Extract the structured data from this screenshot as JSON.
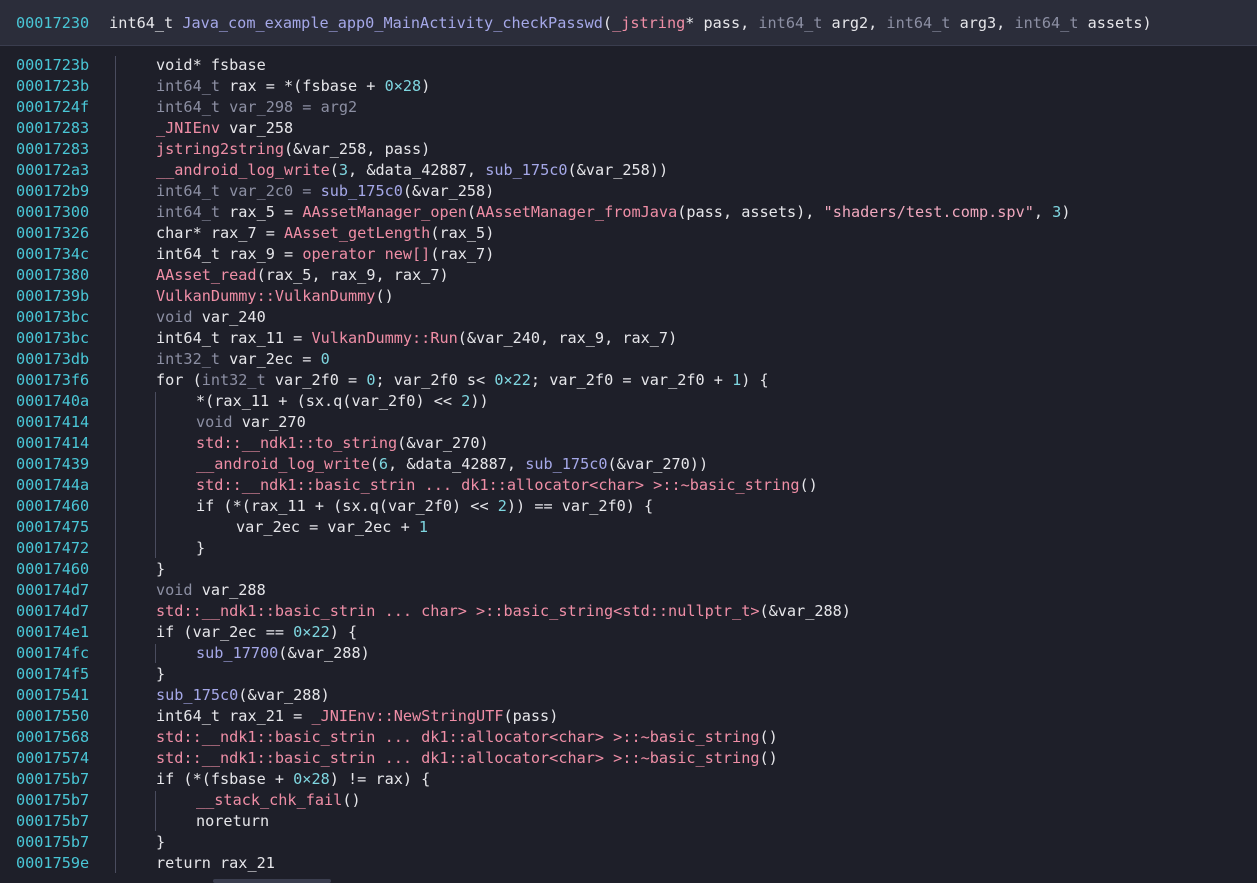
{
  "header": {
    "address": "00017230",
    "signature": [
      {
        "t": "int64_t ",
        "c": "kw"
      },
      {
        "t": "Java_com_example_app0_MainActivity_checkPasswd",
        "c": "imp"
      },
      {
        "t": "(",
        "c": "kw"
      },
      {
        "t": "_jstring",
        "c": "fn"
      },
      {
        "t": "* pass, ",
        "c": "kw"
      },
      {
        "t": "int64_t ",
        "c": "ty"
      },
      {
        "t": "arg2, ",
        "c": "kw"
      },
      {
        "t": "int64_t ",
        "c": "ty"
      },
      {
        "t": "arg3, ",
        "c": "kw"
      },
      {
        "t": "int64_t ",
        "c": "ty"
      },
      {
        "t": "assets)",
        "c": "kw"
      }
    ]
  },
  "lines": [
    {
      "addr": "0001723b",
      "indent": 0,
      "parts": [
        {
          "t": "void",
          "c": "kw"
        },
        {
          "t": "* fsbase",
          "c": "kw"
        }
      ]
    },
    {
      "addr": "0001723b",
      "indent": 0,
      "parts": [
        {
          "t": "int64_t ",
          "c": "ty"
        },
        {
          "t": "rax = *(fsbase + ",
          "c": "kw"
        },
        {
          "t": "0×28",
          "c": "num"
        },
        {
          "t": ")",
          "c": "kw"
        }
      ]
    },
    {
      "addr": "0001724f",
      "indent": 0,
      "parts": [
        {
          "t": "int64_t var_298 = arg2",
          "c": "ty"
        }
      ]
    },
    {
      "addr": "00017283",
      "indent": 0,
      "parts": [
        {
          "t": "_JNIEnv",
          "c": "fn"
        },
        {
          "t": " var_258",
          "c": "kw"
        }
      ]
    },
    {
      "addr": "00017283",
      "indent": 0,
      "parts": [
        {
          "t": "jstring2string",
          "c": "fn"
        },
        {
          "t": "(&var_258, pass)",
          "c": "kw"
        }
      ]
    },
    {
      "addr": "000172a3",
      "indent": 0,
      "parts": [
        {
          "t": "__android_log_write",
          "c": "fn"
        },
        {
          "t": "(",
          "c": "kw"
        },
        {
          "t": "3",
          "c": "num"
        },
        {
          "t": ", &",
          "c": "kw"
        },
        {
          "t": "data_42887",
          "c": "kw"
        },
        {
          "t": ", ",
          "c": "kw"
        },
        {
          "t": "sub_175c0",
          "c": "imp"
        },
        {
          "t": "(&var_258))",
          "c": "kw"
        }
      ]
    },
    {
      "addr": "000172b9",
      "indent": 0,
      "parts": [
        {
          "t": "int64_t var_2c0 = ",
          "c": "ty"
        },
        {
          "t": "sub_175c0",
          "c": "imp"
        },
        {
          "t": "(&var_258)",
          "c": "kw"
        }
      ]
    },
    {
      "addr": "00017300",
      "indent": 0,
      "parts": [
        {
          "t": "int64_t ",
          "c": "ty"
        },
        {
          "t": "rax_5 = ",
          "c": "kw"
        },
        {
          "t": "AAssetManager_open",
          "c": "fn"
        },
        {
          "t": "(",
          "c": "kw"
        },
        {
          "t": "AAssetManager_fromJava",
          "c": "fn"
        },
        {
          "t": "(pass, assets), ",
          "c": "kw"
        },
        {
          "t": "\"shaders/test.comp.spv\"",
          "c": "str"
        },
        {
          "t": ", ",
          "c": "kw"
        },
        {
          "t": "3",
          "c": "num"
        },
        {
          "t": ")",
          "c": "kw"
        }
      ]
    },
    {
      "addr": "00017326",
      "indent": 0,
      "parts": [
        {
          "t": "char",
          "c": "kw"
        },
        {
          "t": "* rax_7 = ",
          "c": "kw"
        },
        {
          "t": "AAsset_getLength",
          "c": "fn"
        },
        {
          "t": "(rax_5)",
          "c": "kw"
        }
      ]
    },
    {
      "addr": "0001734c",
      "indent": 0,
      "parts": [
        {
          "t": "int64_t ",
          "c": "kw"
        },
        {
          "t": "rax_9 = ",
          "c": "kw"
        },
        {
          "t": "operator new[]",
          "c": "fn"
        },
        {
          "t": "(rax_7)",
          "c": "kw"
        }
      ]
    },
    {
      "addr": "00017380",
      "indent": 0,
      "parts": [
        {
          "t": "AAsset_read",
          "c": "fn"
        },
        {
          "t": "(rax_5, rax_9, rax_7)",
          "c": "kw"
        }
      ]
    },
    {
      "addr": "0001739b",
      "indent": 0,
      "parts": [
        {
          "t": "VulkanDummy::VulkanDummy",
          "c": "fn"
        },
        {
          "t": "()",
          "c": "kw"
        }
      ]
    },
    {
      "addr": "000173bc",
      "indent": 0,
      "parts": [
        {
          "t": "void ",
          "c": "ty"
        },
        {
          "t": "var_240",
          "c": "kw"
        }
      ]
    },
    {
      "addr": "000173bc",
      "indent": 0,
      "parts": [
        {
          "t": "int64_t ",
          "c": "kw"
        },
        {
          "t": "rax_11 = ",
          "c": "kw"
        },
        {
          "t": "VulkanDummy::Run",
          "c": "fn"
        },
        {
          "t": "(&var_240, rax_9, rax_7)",
          "c": "kw"
        }
      ]
    },
    {
      "addr": "000173db",
      "indent": 0,
      "parts": [
        {
          "t": "int32_t ",
          "c": "ty"
        },
        {
          "t": "var_2ec = ",
          "c": "kw"
        },
        {
          "t": "0",
          "c": "num"
        }
      ]
    },
    {
      "addr": "000173f6",
      "indent": 0,
      "parts": [
        {
          "t": "for (",
          "c": "kw"
        },
        {
          "t": "int32_t ",
          "c": "ty"
        },
        {
          "t": "var_2f0 = ",
          "c": "kw"
        },
        {
          "t": "0",
          "c": "num"
        },
        {
          "t": "; var_2f0 s< ",
          "c": "kw"
        },
        {
          "t": "0×22",
          "c": "num"
        },
        {
          "t": "; var_2f0 = var_2f0 + ",
          "c": "kw"
        },
        {
          "t": "1",
          "c": "num"
        },
        {
          "t": ") {",
          "c": "kw"
        }
      ]
    },
    {
      "addr": "0001740a",
      "indent": 1,
      "parts": [
        {
          "t": "*(rax_11 + (sx.q(var_2f0) << ",
          "c": "kw"
        },
        {
          "t": "2",
          "c": "num"
        },
        {
          "t": "))",
          "c": "kw"
        }
      ]
    },
    {
      "addr": "00017414",
      "indent": 1,
      "parts": [
        {
          "t": "void ",
          "c": "ty"
        },
        {
          "t": "var_270",
          "c": "kw"
        }
      ]
    },
    {
      "addr": "00017414",
      "indent": 1,
      "parts": [
        {
          "t": "std::__ndk1::to_string",
          "c": "fn"
        },
        {
          "t": "(&var_270)",
          "c": "kw"
        }
      ]
    },
    {
      "addr": "00017439",
      "indent": 1,
      "parts": [
        {
          "t": "__android_log_write",
          "c": "fn"
        },
        {
          "t": "(",
          "c": "kw"
        },
        {
          "t": "6",
          "c": "num"
        },
        {
          "t": ", &",
          "c": "kw"
        },
        {
          "t": "data_42887",
          "c": "kw"
        },
        {
          "t": ", ",
          "c": "kw"
        },
        {
          "t": "sub_175c0",
          "c": "imp"
        },
        {
          "t": "(&var_270))",
          "c": "kw"
        }
      ]
    },
    {
      "addr": "0001744a",
      "indent": 1,
      "parts": [
        {
          "t": "std::__ndk1::basic_strin ... dk1::allocator<char> >",
          "c": "fn"
        },
        {
          "t": "::~basic_string",
          "c": "fn"
        },
        {
          "t": "()",
          "c": "kw"
        }
      ]
    },
    {
      "addr": "00017460",
      "indent": 1,
      "parts": [
        {
          "t": "if (*(rax_11 + (sx.q(var_2f0) << ",
          "c": "kw"
        },
        {
          "t": "2",
          "c": "num"
        },
        {
          "t": ")) == var_2f0) {",
          "c": "kw"
        }
      ]
    },
    {
      "addr": "00017475",
      "indent": 2,
      "parts": [
        {
          "t": "var_2ec = var_2ec + ",
          "c": "kw"
        },
        {
          "t": "1",
          "c": "num"
        }
      ]
    },
    {
      "addr": "00017472",
      "indent": 1,
      "parts": [
        {
          "t": "}",
          "c": "kw"
        }
      ]
    },
    {
      "addr": "00017460",
      "indent": 0,
      "parts": [
        {
          "t": "}",
          "c": "kw"
        }
      ]
    },
    {
      "addr": "000174d7",
      "indent": 0,
      "parts": [
        {
          "t": "void ",
          "c": "ty"
        },
        {
          "t": "var_288",
          "c": "kw"
        }
      ]
    },
    {
      "addr": "000174d7",
      "indent": 0,
      "parts": [
        {
          "t": "std::__ndk1::basic_strin ... char> >::basic_string<std::nullptr_t>",
          "c": "fn"
        },
        {
          "t": "(&var_288)",
          "c": "kw"
        }
      ]
    },
    {
      "addr": "000174e1",
      "indent": 0,
      "parts": [
        {
          "t": "if (var_2ec == ",
          "c": "kw"
        },
        {
          "t": "0×22",
          "c": "num"
        },
        {
          "t": ") {",
          "c": "kw"
        }
      ]
    },
    {
      "addr": "000174fc",
      "indent": 1,
      "parts": [
        {
          "t": "sub_17700",
          "c": "imp"
        },
        {
          "t": "(&var_288)",
          "c": "kw"
        }
      ]
    },
    {
      "addr": "000174f5",
      "indent": 0,
      "parts": [
        {
          "t": "}",
          "c": "kw"
        }
      ]
    },
    {
      "addr": "00017541",
      "indent": 0,
      "parts": [
        {
          "t": "sub_175c0",
          "c": "imp"
        },
        {
          "t": "(&var_288)",
          "c": "kw"
        }
      ]
    },
    {
      "addr": "00017550",
      "indent": 0,
      "parts": [
        {
          "t": "int64_t ",
          "c": "kw"
        },
        {
          "t": "rax_21 = ",
          "c": "kw"
        },
        {
          "t": "_JNIEnv::NewStringUTF",
          "c": "fn"
        },
        {
          "t": "(pass)",
          "c": "kw"
        }
      ]
    },
    {
      "addr": "00017568",
      "indent": 0,
      "parts": [
        {
          "t": "std::__ndk1::basic_strin ... dk1::allocator<char> >",
          "c": "fn"
        },
        {
          "t": "::~basic_string",
          "c": "fn"
        },
        {
          "t": "()",
          "c": "kw"
        }
      ]
    },
    {
      "addr": "00017574",
      "indent": 0,
      "parts": [
        {
          "t": "std::__ndk1::basic_strin ... dk1::allocator<char> >",
          "c": "fn"
        },
        {
          "t": "::~basic_string",
          "c": "fn"
        },
        {
          "t": "()",
          "c": "kw"
        }
      ]
    },
    {
      "addr": "000175b7",
      "indent": 0,
      "parts": [
        {
          "t": "if (*(fsbase + ",
          "c": "kw"
        },
        {
          "t": "0×28",
          "c": "num"
        },
        {
          "t": ") != rax) {",
          "c": "kw"
        }
      ]
    },
    {
      "addr": "000175b7",
      "indent": 1,
      "parts": [
        {
          "t": "__stack_chk_fail",
          "c": "fn"
        },
        {
          "t": "()",
          "c": "kw"
        }
      ]
    },
    {
      "addr": "000175b7",
      "indent": 1,
      "parts": [
        {
          "t": "noreturn",
          "c": "kw"
        }
      ]
    },
    {
      "addr": "000175b7",
      "indent": 0,
      "parts": [
        {
          "t": "}",
          "c": "kw"
        }
      ]
    },
    {
      "addr": "0001759e",
      "indent": 0,
      "parts": [
        {
          "t": "return ",
          "c": "kw"
        },
        {
          "t": "rax_21",
          "c": "kw"
        }
      ]
    }
  ],
  "guides": [
    {
      "indent": 0,
      "from": 0,
      "to": 38
    },
    {
      "indent": 1,
      "from": 16,
      "to": 23
    },
    {
      "indent": 1,
      "from": 28,
      "to": 28
    },
    {
      "indent": 1,
      "from": 35,
      "to": 36
    }
  ]
}
